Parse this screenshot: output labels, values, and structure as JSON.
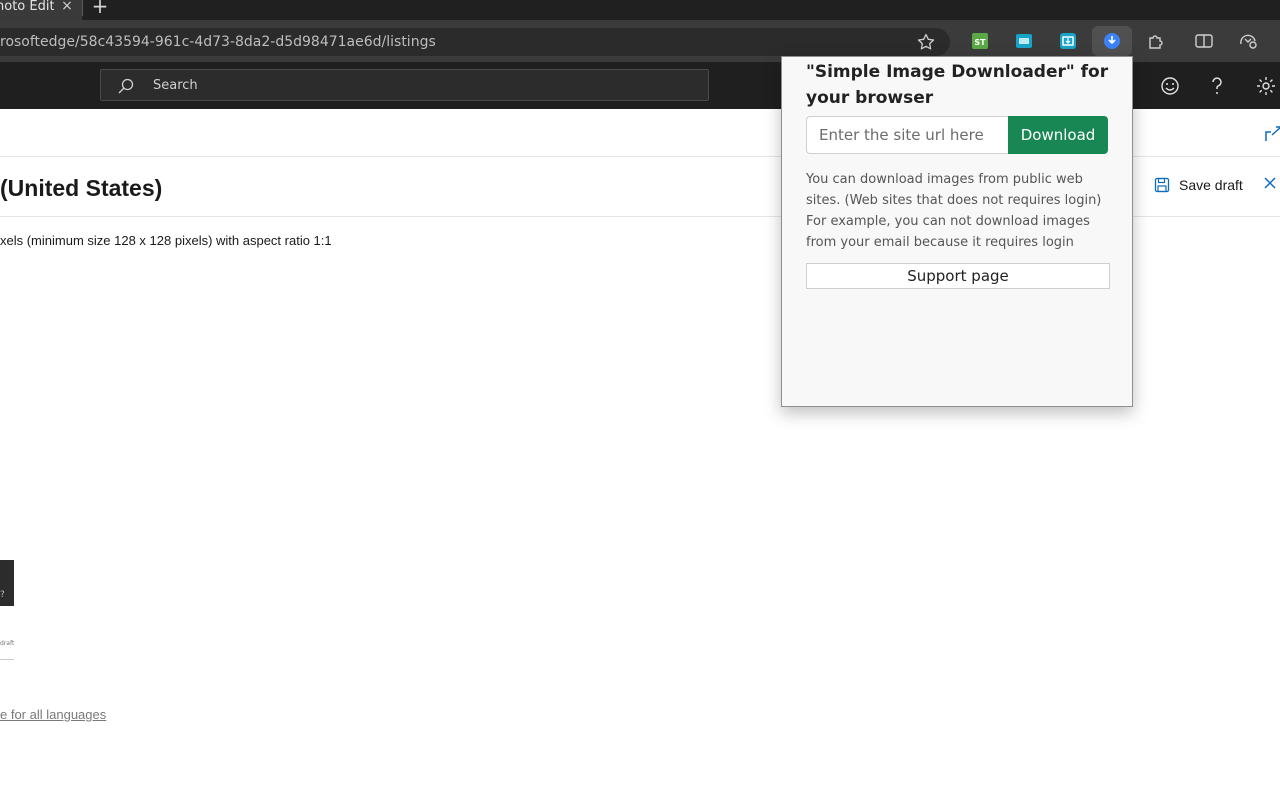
{
  "browser": {
    "tab_title": "hoto Edit",
    "url": "rosoftedge/58c43594-961c-4d73-8da2-d5d98471ae6d/listings",
    "extensions": [
      {
        "name": "st-extension-icon",
        "label": "ST",
        "color": "#5aa846"
      },
      {
        "name": "web-capture-icon",
        "color": "#1aa3c8"
      },
      {
        "name": "screenshot-extension-icon",
        "color": "#1aa3c8"
      },
      {
        "name": "image-downloader-icon",
        "color": "#3b82f6"
      }
    ]
  },
  "header": {
    "search_placeholder": "Search"
  },
  "page": {
    "title": "(United States)",
    "save_draft_label": "Save draft",
    "description": "xels (minimum size 128 x 128 pixels) with aspect ratio 1:1",
    "thumb_q": "?",
    "thumb_draft": "draft",
    "lang_link": "e for all languages"
  },
  "popup": {
    "title": "\"Simple Image Downloader\" for your browser",
    "input_placeholder": "Enter the site url here",
    "download_label": "Download",
    "info_text": "You can download images from public web sites. (Web sites that does not requires login) For example, you can not download images from your email because it requires login",
    "support_label": "Support page",
    "accent_color": "#198754"
  }
}
